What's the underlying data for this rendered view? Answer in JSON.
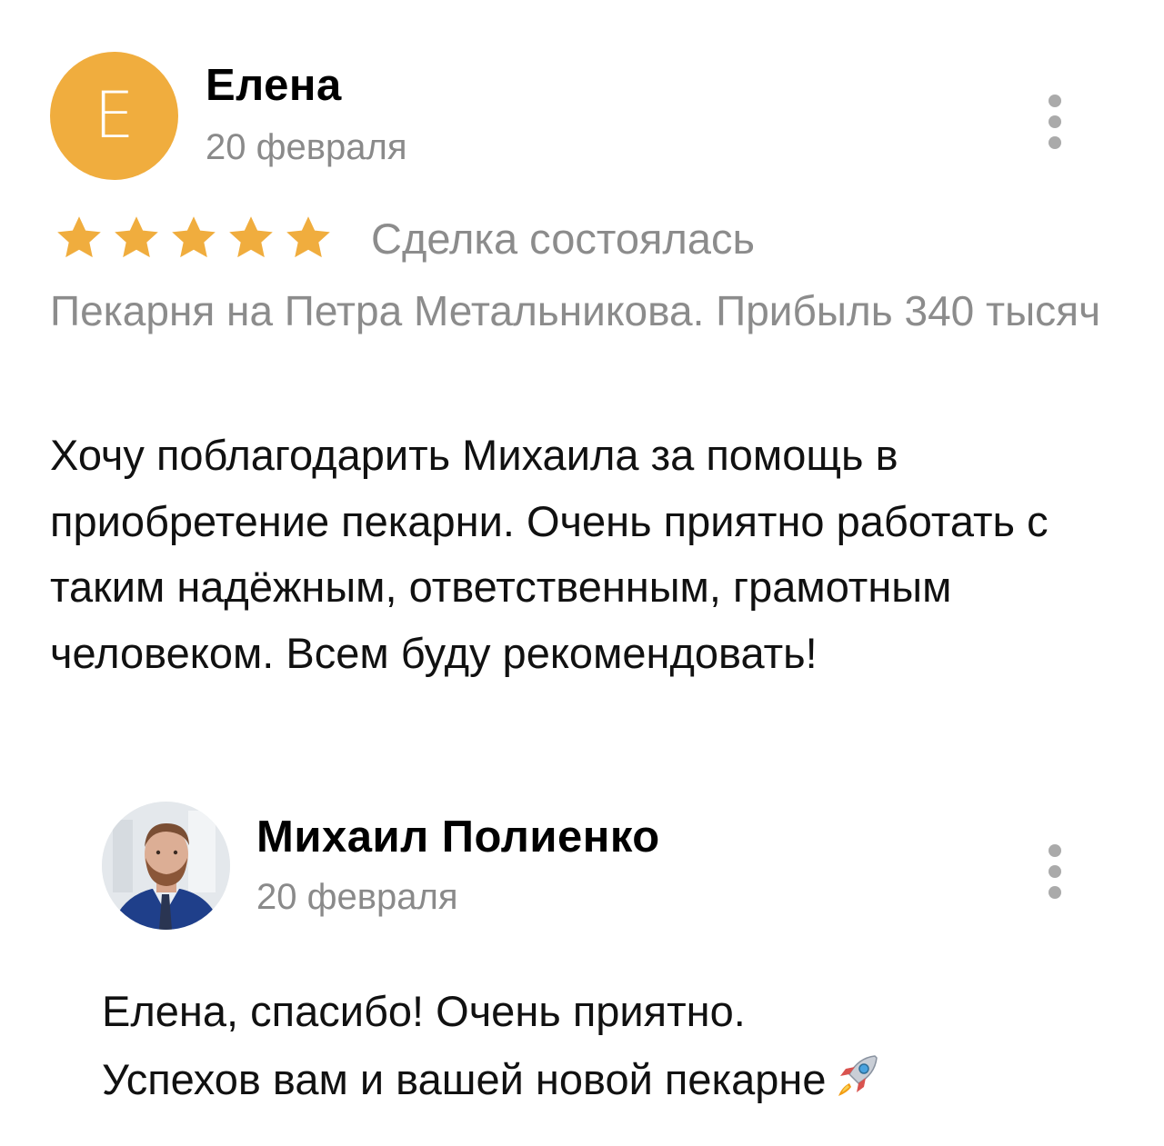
{
  "review": {
    "author": {
      "avatar_letter": "Е",
      "avatar_color": "#f0ad3e",
      "name": "Елена"
    },
    "date": "20 февраля",
    "rating": 5,
    "star_color": "#f0ad3e",
    "status": "Сделка состоялась",
    "deal_title": "Пекарня на Петра Метальникова. Прибыль 340 тысяч",
    "text": "Хочу поблагодарить Михаила за помощь в приобретение пекарни. Очень приятно работать с таким надёжным, ответственным, грамотным человеком. Всем буду рекомендовать!",
    "menu_icon": "more-vertical-icon"
  },
  "reply": {
    "author": {
      "name": "Михаил Полиенко",
      "avatar_icon": "user-photo-avatar"
    },
    "date": "20 февраля",
    "text_line1": "Елена, спасибо! Очень приятно.",
    "text_line2": "Успехов вам и вашей новой пекарне",
    "emoji_icon": "rocket-icon",
    "menu_icon": "more-vertical-icon"
  }
}
